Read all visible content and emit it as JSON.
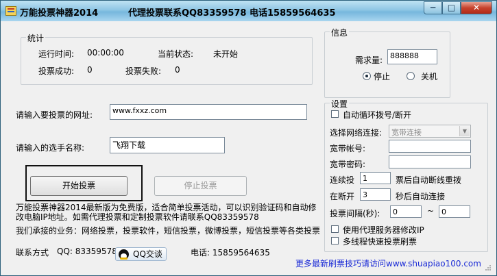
{
  "window": {
    "title": "万能投票神器2014",
    "contact": "代理投票联系QQ83359578 电话15859564635",
    "min_label": "−",
    "max_label": "□",
    "close_label": "✕"
  },
  "stats": {
    "group_label": "统计",
    "runtime_label": "运行时间:",
    "runtime_value": "00:00:00",
    "status_label": "当前状态:",
    "status_value": "未开始",
    "success_label": "投票成功:",
    "success_value": "0",
    "fail_label": "投票失败:",
    "fail_value": "0"
  },
  "form": {
    "url_label": "请输入要投票的网址:",
    "url_value": "www.fxxz.com",
    "name_label": "请输入的选手名称:",
    "name_value": "飞翔下载"
  },
  "buttons": {
    "start": "开始投票",
    "stop": "停止投票"
  },
  "info": {
    "group_label": "信息",
    "demand_label": "需求量:",
    "demand_value": "888888",
    "radio_stop": "停止",
    "radio_shutdown": "关机"
  },
  "settings": {
    "group_label": "设置",
    "auto_redial": "自动循环拨号/断开",
    "network_label": "选择网络连接:",
    "network_value": "宽带连接",
    "account_label": "宽带帐号:",
    "account_value": "",
    "password_label": "宽带密码:",
    "password_value": "",
    "continuous_label": "连续投",
    "continuous_value": "1",
    "continuous_suffix": "票后自动断线重拨",
    "after_label": "在断开",
    "after_value": "3",
    "after_suffix": "秒后自动连接",
    "interval_label": "投票间隔(秒):",
    "interval_from": "0",
    "interval_sep": "~",
    "interval_to": "0",
    "use_proxy": "使用代理服务器修改IP",
    "multithread": "多线程快速投票刷票"
  },
  "notice": {
    "line1": "万能投票神器2014最新版为免费版，适合简单投票活动，可以识别验证码和自动修",
    "line2": "改电脑IP地址。如需代理投票和定制投票软件请联系QQ83359578",
    "business": "我们承接的业务：网络投票，投票软件，短信投票，微博投票，短信投票等各类投票"
  },
  "footer": {
    "contact_label": "联系方式",
    "qq_text": "QQ: 83359578",
    "qq_button": "QQ交谈",
    "phone_text": "电话: 15859564635",
    "link_text": "更多最新刷票技巧请访问www.shuapiao100.com"
  }
}
